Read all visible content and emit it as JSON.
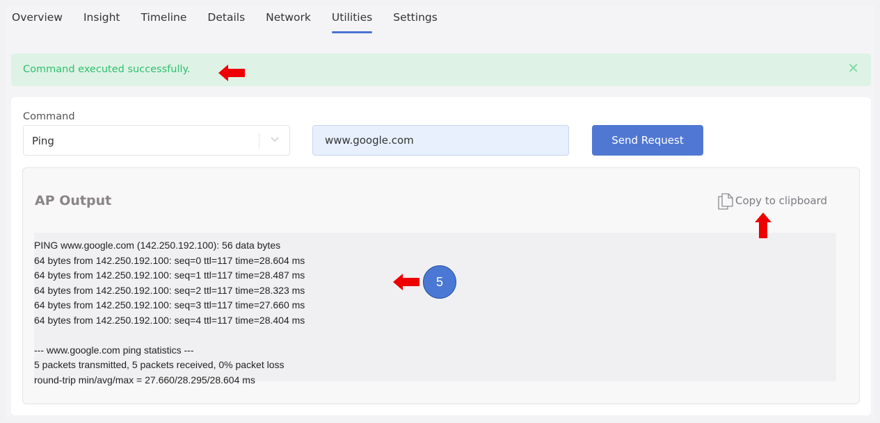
{
  "tabs": [
    {
      "label": "Overview"
    },
    {
      "label": "Insight"
    },
    {
      "label": "Timeline"
    },
    {
      "label": "Details"
    },
    {
      "label": "Network"
    },
    {
      "label": "Utilities",
      "active": true
    },
    {
      "label": "Settings"
    }
  ],
  "alert": {
    "message": "Command executed successfully.",
    "close_icon": "close-icon",
    "color": "#2fbf6e"
  },
  "command": {
    "label": "Command",
    "selected": "Ping",
    "host_value": "www.google.com",
    "send_label": "Send Request"
  },
  "output": {
    "title": "AP Output",
    "copy_label": "Copy to clipboard",
    "copy_icon": "copy-icon",
    "lines": [
      "PING www.google.com (142.250.192.100): 56 data bytes",
      "64 bytes from 142.250.192.100: seq=0 ttl=117 time=28.604 ms",
      "64 bytes from 142.250.192.100: seq=1 ttl=117 time=28.487 ms",
      "64 bytes from 142.250.192.100: seq=2 ttl=117 time=28.323 ms",
      "64 bytes from 142.250.192.100: seq=3 ttl=117 time=27.660 ms",
      "64 bytes from 142.250.192.100: seq=4 ttl=117 time=28.404 ms",
      "",
      "--- www.google.com ping statistics ---",
      "5 packets transmitted, 5 packets received, 0% packet loss",
      "round-trip min/avg/max = 27.660/28.295/28.604 ms"
    ]
  },
  "annotation": {
    "badge_number": "5",
    "arrow_color": "#ee0000"
  },
  "colors": {
    "accent": "#5078d2",
    "success_bg": "#def3e6"
  }
}
